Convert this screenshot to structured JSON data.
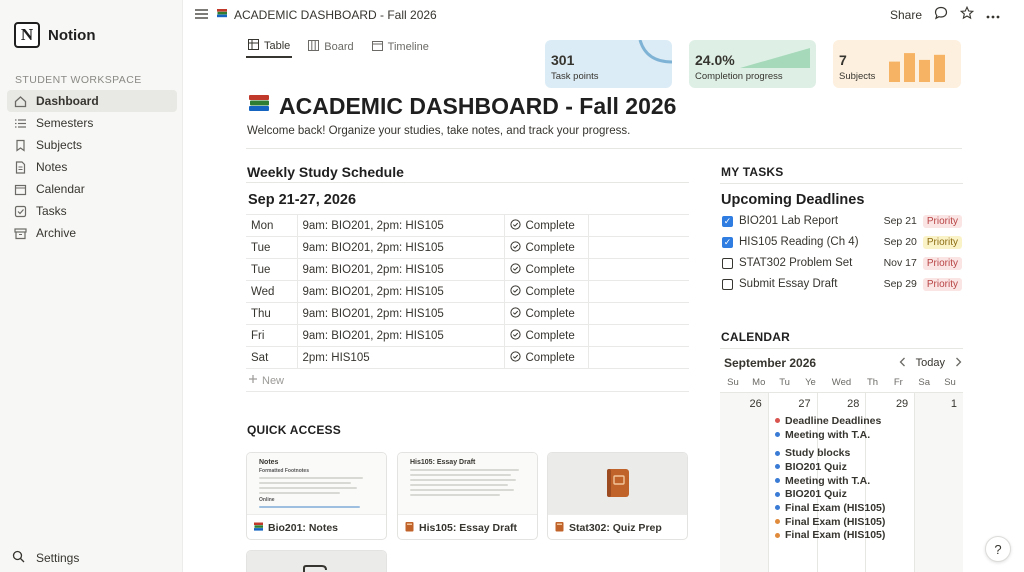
{
  "app": {
    "name": "Notion",
    "logo_letter": "N"
  },
  "sidebar": {
    "section_label": "STUDENT WORKSPACE",
    "items": [
      {
        "label": "Dashboard",
        "icon": "home-icon",
        "active": true
      },
      {
        "label": "Semesters",
        "icon": "list-icon"
      },
      {
        "label": "Subjects",
        "icon": "bookmark-icon"
      },
      {
        "label": "Notes",
        "icon": "document-icon"
      },
      {
        "label": "Calendar",
        "icon": "calendar-icon"
      },
      {
        "label": "Tasks",
        "icon": "checkbox-icon"
      },
      {
        "label": "Archive",
        "icon": "archive-icon"
      }
    ],
    "settings_label": "Settings"
  },
  "topbar": {
    "breadcrumb": "ACADEMIC DASHBOARD - Fall 2026",
    "share_label": "Share"
  },
  "views": {
    "tabs": [
      {
        "label": "Table",
        "active": true
      },
      {
        "label": "Board"
      },
      {
        "label": "Timeline"
      }
    ]
  },
  "stats": [
    {
      "value": "301",
      "label": "Task points",
      "color": "#dcecf6"
    },
    {
      "value": "24.0%",
      "label": "Completion progress",
      "color": "#def0e6"
    },
    {
      "value": "7",
      "label": "Subjects",
      "color": "#fdf0df",
      "bars": [
        0.6,
        0.85,
        0.65,
        0.8
      ]
    }
  ],
  "page": {
    "title": "ACADEMIC DASHBOARD - Fall 2026",
    "subtitle": "Welcome back! Organize your studies, take notes, and track your progress."
  },
  "schedule": {
    "heading": "Weekly Study Schedule",
    "range": "Sep 21-27, 2026",
    "rows": [
      {
        "day": "Mon",
        "plan": "9am: BIO201, 2pm: HIS105",
        "status": "Complete"
      },
      {
        "day": "Tue",
        "plan": "9am: BIO201, 2pm: HIS105",
        "status": "Complete"
      },
      {
        "day": "Tue",
        "plan": "9am: BIO201, 2pm: HIS105",
        "status": "Complete"
      },
      {
        "day": "Wed",
        "plan": "9am: BIO201, 2pm: HIS105",
        "status": "Complete"
      },
      {
        "day": "Thu",
        "plan": "9am: BIO201, 2pm: HIS105",
        "status": "Complete"
      },
      {
        "day": "Fri",
        "plan": "9am: BIO201, 2pm: HIS105",
        "status": "Complete"
      },
      {
        "day": "Sat",
        "plan": "2pm: HIS105",
        "status": "Complete"
      }
    ],
    "new_label": "New"
  },
  "quick_access": {
    "heading": "QUICK ACCESS",
    "cards": [
      {
        "caption": "Bio201: Notes",
        "icon": "books-icon",
        "preview_title": "Notes",
        "preview_sub": "Formatted Footnotes",
        "preview_sub2": "Online"
      },
      {
        "caption": "His105: Essay Draft",
        "icon": "book-icon",
        "preview_title": "His105: Essay Draft"
      },
      {
        "caption": "Stat302: Quiz Prep",
        "icon": "book-icon"
      }
    ]
  },
  "tasks": {
    "heading": "MY TASKS",
    "subheading": "Upcoming Deadlines",
    "items": [
      {
        "name": "BIO201 Lab Report",
        "date": "Sep 21",
        "badge": "Priority",
        "checked": true,
        "badge_color": "red"
      },
      {
        "name": "HIS105 Reading (Ch 4)",
        "date": "Sep 20",
        "badge": "Priority",
        "checked": true,
        "badge_color": "yellow"
      },
      {
        "name": "STAT302 Problem Set",
        "date": "Nov 17",
        "badge": "Priority",
        "checked": false,
        "badge_color": "red"
      },
      {
        "name": "Submit Essay Draft",
        "date": "Sep 29",
        "badge": "Priority",
        "checked": false,
        "badge_color": "red"
      }
    ]
  },
  "calendar": {
    "heading": "CALENDAR",
    "month": "September 2026",
    "today_label": "Today",
    "weekdays": [
      "Su",
      "Mo",
      "Tu",
      "Ye",
      "Wed",
      "Th",
      "Fr",
      "Sa",
      "Su"
    ],
    "day_numbers": [
      "26",
      "27",
      "28",
      "29",
      "1"
    ],
    "events": [
      {
        "label": "Deadline Deadlines",
        "color": "#d9534f"
      },
      {
        "label": "Meeting with T.A.",
        "color": "#3a7bd5"
      },
      {
        "label": "Study blocks",
        "color": "#3a7bd5",
        "gap": true
      },
      {
        "label": "BIO201 Quiz",
        "color": "#3a7bd5"
      },
      {
        "label": "Meeting with T.A.",
        "color": "#3a7bd5"
      },
      {
        "label": "BIO201 Quiz",
        "color": "#3a7bd5"
      },
      {
        "label": "Final Exam (HIS105)",
        "color": "#3a7bd5"
      },
      {
        "label": "Final Exam (HIS105)",
        "color": "#e08a3c"
      },
      {
        "label": "Final Exam (HIS105)",
        "color": "#e08a3c"
      }
    ]
  },
  "help_label": "?"
}
